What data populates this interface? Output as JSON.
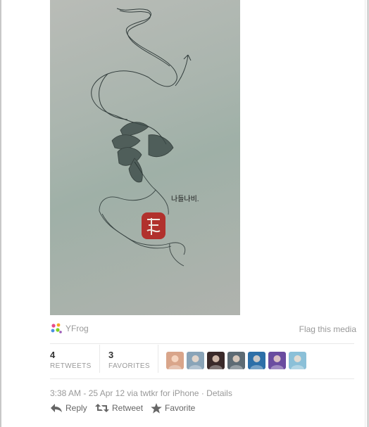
{
  "media": {
    "provider_name": "YFrog",
    "flag_label": "Flag this media",
    "painting_text": "나들나비.",
    "seal_icon": "red-seal-stamp"
  },
  "stats": {
    "retweets": {
      "count": "4",
      "label": "RETWEETS"
    },
    "favorites": {
      "count": "3",
      "label": "FAVORITES"
    }
  },
  "favorited_by": [
    {
      "name": "avatar-1",
      "color": "#d9a58a"
    },
    {
      "name": "avatar-2",
      "color": "#8aa4b8"
    },
    {
      "name": "avatar-3",
      "color": "#3a2a2a"
    },
    {
      "name": "avatar-4",
      "color": "#5d6b74"
    },
    {
      "name": "avatar-5",
      "color": "#2d6fa8"
    },
    {
      "name": "avatar-6",
      "color": "#6a4ca0"
    },
    {
      "name": "avatar-7",
      "color": "#8bc0d8"
    }
  ],
  "meta": {
    "timestamp": "3:38 AM - 25 Apr 12",
    "via_prefix": "via",
    "client": "twtkr for iPhone",
    "separator": "·",
    "details_label": "Details"
  },
  "actions": {
    "reply_label": "Reply",
    "retweet_label": "Retweet",
    "favorite_label": "Favorite"
  },
  "colors": {
    "muted_text": "#999999",
    "action_text": "#666666",
    "seal_red": "#b3231f"
  }
}
